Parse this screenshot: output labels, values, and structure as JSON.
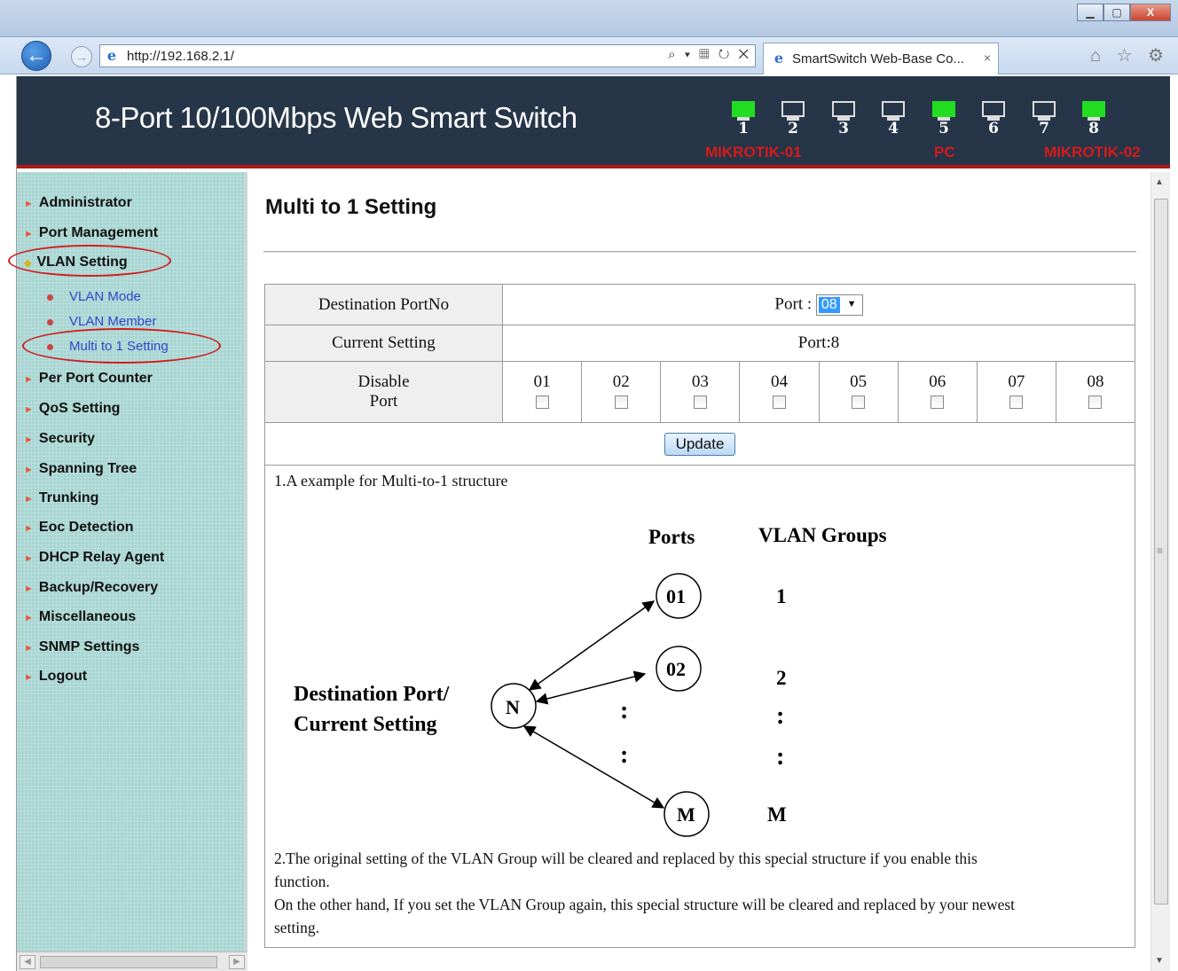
{
  "browser": {
    "url": "http://192.168.2.1/",
    "tab_title": "SmartSwitch Web-Base Co...",
    "tab_close": "×",
    "url_tools": "⌕ ▾ ▦ ↻ ✕",
    "back": "←",
    "forward": "→",
    "window_minimize": "▁",
    "window_maximize": "▢",
    "window_close": "X",
    "tools": "⌂ ☆ ⚙"
  },
  "header": {
    "title": "8-Port 10/100Mbps Web Smart Switch",
    "ports": [
      {
        "num": "1",
        "active": true
      },
      {
        "num": "2",
        "active": false
      },
      {
        "num": "3",
        "active": false
      },
      {
        "num": "4",
        "active": false
      },
      {
        "num": "5",
        "active": true
      },
      {
        "num": "6",
        "active": false
      },
      {
        "num": "7",
        "active": false
      },
      {
        "num": "8",
        "active": true
      }
    ],
    "port_labels": {
      "p1": "MIKROTIK-01",
      "p5": "PC",
      "p8": "MIKROTIK-02"
    },
    "colors": {
      "background": "#263548",
      "accent": "#b01818",
      "link_active": "#22dd22",
      "annotation": "#d81a1a"
    }
  },
  "sidebar": {
    "items": [
      {
        "label": "Administrator"
      },
      {
        "label": "Port Management"
      },
      {
        "label": "VLAN Setting"
      },
      {
        "label": "Per Port Counter"
      },
      {
        "label": "QoS Setting"
      },
      {
        "label": "Security"
      },
      {
        "label": "Spanning Tree"
      },
      {
        "label": "Trunking"
      },
      {
        "label": "Eoc Detection"
      },
      {
        "label": "DHCP Relay Agent"
      },
      {
        "label": "Backup/Recovery"
      },
      {
        "label": "Miscellaneous"
      },
      {
        "label": "SNMP Settings"
      },
      {
        "label": "Logout"
      }
    ],
    "vlan_sub": [
      {
        "label": "VLAN Mode"
      },
      {
        "label": "VLAN Member"
      },
      {
        "label": "Multi to 1 Setting"
      }
    ]
  },
  "main": {
    "title": "Multi to 1 Setting",
    "dest_label": "Destination PortNo",
    "port_prefix": "Port :",
    "port_value": "08",
    "current_label": "Current Setting",
    "current_value": "Port:8",
    "disable_label_1": "Disable",
    "disable_label_2": "Port",
    "ports": [
      "01",
      "02",
      "03",
      "04",
      "05",
      "06",
      "07",
      "08"
    ],
    "update_label": "Update",
    "example_title": "1.A example for Multi-to-1 structure",
    "note_2a": "2.The original setting of the VLAN Group will be cleared and replaced by this special structure if you enable this",
    "note_2b": "function.",
    "note_3a": "On the other hand, If you set the VLAN Group again, this special structure will be cleared and replaced by your newest",
    "note_3b": "setting."
  },
  "diagram": {
    "ports_heading": "Ports",
    "groups_heading": "VLAN Groups",
    "dest_line1": "Destination Port/",
    "dest_line2": "Current Setting",
    "center": "N",
    "nodes": [
      "01",
      "02",
      "M"
    ],
    "groups": [
      "1",
      "2",
      "M"
    ],
    "dots": ":"
  }
}
